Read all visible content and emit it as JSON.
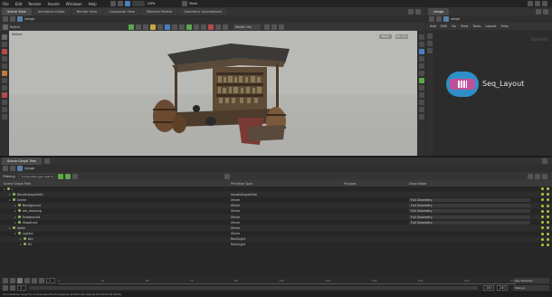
{
  "menubar": {
    "items": [
      "File",
      "Edit",
      "Render",
      "Assets",
      "Windows",
      "Help"
    ],
    "context_label": "LOPs",
    "context2": "Main"
  },
  "top_tabs": [
    "Scene View",
    "Animation Editor",
    "Render View",
    "Composite View",
    "Material Palette",
    "Geometry Spreadsheet"
  ],
  "right_tabs": [
    "/stage"
  ],
  "viewport": {
    "path": "/stage",
    "camera_label": "Select",
    "overlay_tl": "Select",
    "btn1": "Persp",
    "btn2": "No cam",
    "bg": "#b9bab6",
    "scene_label": "Render the camera"
  },
  "network": {
    "path": "stage",
    "menu": [
      "Add",
      "Edit",
      "Go",
      "View",
      "Tools",
      "Layout",
      "Help"
    ],
    "node_label": "Seq_Layout",
    "watermark": "Solaris"
  },
  "bottom_tabs": [
    "Scene Graph Tree"
  ],
  "bottom_path": "/stage",
  "tree_toolbar": {
    "filter_label": "Filtering",
    "search_label": "Composited geo search"
  },
  "tree_header": {
    "path": "Scene Graph Path",
    "type": "Primitive Type",
    "purpose": "Purpose",
    "draw": "Draw Mode"
  },
  "tree_rows": [
    {
      "name": "/",
      "type": "",
      "purpose": "",
      "draw": "",
      "indent": 0
    },
    {
      "name": "HoudiniLayerInfo",
      "type": "HoudiniLayerInfo",
      "purpose": "",
      "draw": "",
      "indent": 1
    },
    {
      "name": "Scene",
      "type": "Xform",
      "purpose": "",
      "draw": "Full Geometry",
      "indent": 1
    },
    {
      "name": "Background",
      "type": "Xform",
      "purpose": "",
      "draw": "Full Geometry",
      "indent": 2
    },
    {
      "name": "set_dressing",
      "type": "Xform",
      "purpose": "",
      "draw": "Full Geometry",
      "indent": 2
    },
    {
      "name": "Foreground",
      "type": "Xform",
      "purpose": "",
      "draw": "Full Geometry",
      "indent": 2
    },
    {
      "name": "Shopfront",
      "type": "Xform",
      "purpose": "",
      "draw": "Full Geometry",
      "indent": 2
    },
    {
      "name": "lights",
      "type": "Xform",
      "purpose": "",
      "draw": "",
      "indent": 1
    },
    {
      "name": "Lights1",
      "type": "Xform",
      "purpose": "",
      "draw": "",
      "indent": 2
    },
    {
      "name": "key",
      "type": "RectLight",
      "purpose": "",
      "draw": "",
      "indent": 3
    },
    {
      "name": "fill",
      "type": "RectLight",
      "purpose": "",
      "draw": "",
      "indent": 3
    }
  ],
  "timeline": {
    "frame": "1",
    "start": "1",
    "end": "240",
    "end2": "240",
    "ticks": [
      "1",
      "24",
      "48",
      "72",
      "96",
      "120",
      "144",
      "168",
      "192",
      "216",
      "240"
    ]
  },
  "statusbar": {
    "left": "Successfully saved to /home/user/Houdini/layout_shot01.hip (Sat Jul 25 10:21:03 2020)",
    "right1": "Manual",
    "right2": "Key Selected"
  }
}
